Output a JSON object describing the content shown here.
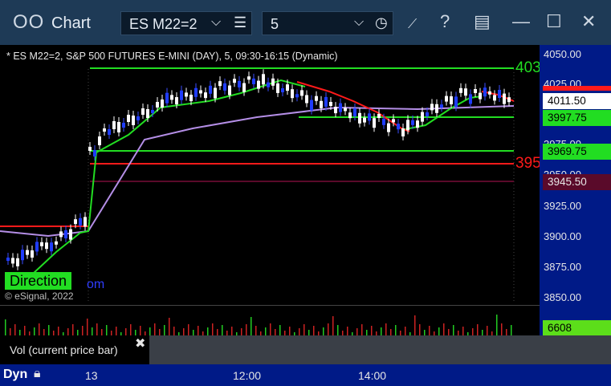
{
  "window": {
    "title": "Chart",
    "symbol": "ES M22=2",
    "interval": "5"
  },
  "chart": {
    "header": "* ES M22=2, S&P 500 FUTURES E-MINI (DAY), 5, 09:30-16:15 (Dynamic)",
    "copyright": "© eSignal, 2022",
    "direction_label": "Direction",
    "direction_tail": "om",
    "level_label_top": "403",
    "level_label_red": "395",
    "y_ticks": [
      "4050.00",
      "4025.00",
      "3975.00",
      "3950.00",
      "3925.00",
      "3900.00",
      "3875.00",
      "3850.00"
    ],
    "price_tags": {
      "current": "4011.50",
      "green_upper": "3997.75",
      "green_lower": "3969.75",
      "maroon": "3945.50"
    },
    "colors": {
      "green": "#22dd22",
      "red": "#ff1a1a",
      "purple": "#b48ee6",
      "axis_bg": "#001a87",
      "tag_current_bg": "#ffffff",
      "tag_maroon_bg": "#5a0a2a"
    }
  },
  "volume": {
    "label": "Vol (current price bar)",
    "value": "6608"
  },
  "bottom": {
    "mode": "Dyn",
    "x_ticks": [
      "13",
      "12:00",
      "14:00"
    ]
  }
}
